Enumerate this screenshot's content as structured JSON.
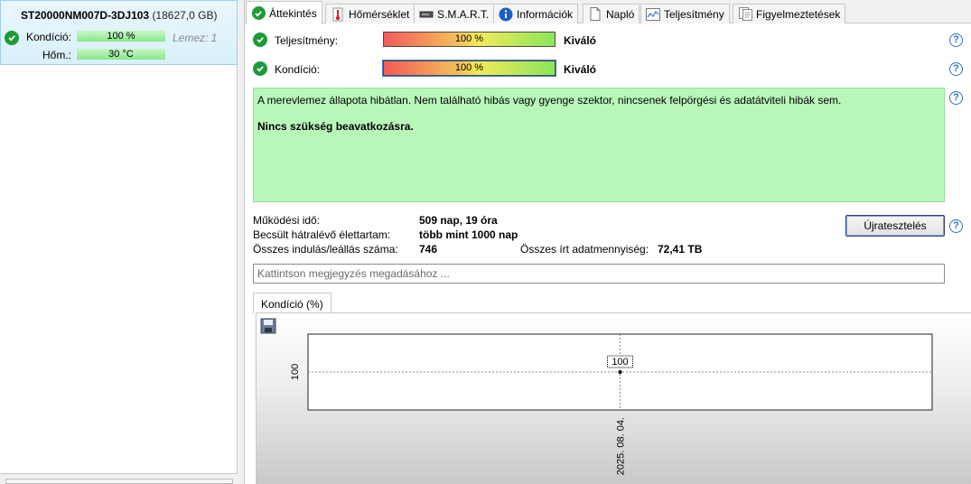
{
  "drive": {
    "name": "ST20000NM007D-3DJ103",
    "size": "(18627,0 GB)",
    "condition_label": "Kondíció:",
    "condition_value": "100 %",
    "lemez": "Lemez: 1",
    "temp_label": "Hőm.:",
    "temp_value": "30 °C"
  },
  "tabs": [
    {
      "label": "Áttekintés",
      "icon": "check-circle-icon"
    },
    {
      "label": "Hőmérséklet",
      "icon": "thermometer-icon"
    },
    {
      "label": "S.M.A.R.T.",
      "icon": "drive-icon"
    },
    {
      "label": "Információk",
      "icon": "info-icon"
    },
    {
      "label": "Napló",
      "icon": "document-icon"
    },
    {
      "label": "Teljesítmény",
      "icon": "performance-chart-icon"
    },
    {
      "label": "Figyelmeztetések",
      "icon": "warnings-icon"
    }
  ],
  "overview": {
    "performance_label": "Teljesítmény:",
    "performance_value": "100 %",
    "performance_rating": "Kiváló",
    "performance_percent": 100,
    "condition_label": "Kondíció:",
    "condition_value": "100 %",
    "condition_rating": "Kiváló",
    "condition_percent": 100
  },
  "status": {
    "message": "A merevlemez állapota hibátlan. Nem található hibás vagy gyenge szektor, nincsenek felpörgési és adatátviteli hibák sem.",
    "action": "Nincs szükség beavatkozásra."
  },
  "stats": {
    "uptime_label": "Működési idő:",
    "uptime_value": "509 nap, 19 óra",
    "lifetime_label": "Becsült hátralévő élettartam:",
    "lifetime_value": "több mint 1000 nap",
    "startstop_label": "Összes indulás/leállás száma:",
    "startstop_value": "746",
    "written_label": "Összes írt adatmennyiség:",
    "written_value": "72,41 TB"
  },
  "retest_label": "Újratesztelés",
  "note_placeholder": "Kattintson megjegyzés megadásához ...",
  "chart_tab_label": "Kondíció  (%)",
  "colors": {
    "accent_ok": "#1e9a3a",
    "status_bg": "#b9f7b9",
    "help_blue": "#2a6fc9"
  },
  "chart_data": {
    "type": "line",
    "x": [
      "2025. 08. 04."
    ],
    "series": [
      {
        "values": [
          100
        ]
      }
    ],
    "ylim": [
      100,
      100
    ],
    "ytick_labels": [
      "100"
    ],
    "data_labels": [
      "100"
    ],
    "grid": true
  }
}
